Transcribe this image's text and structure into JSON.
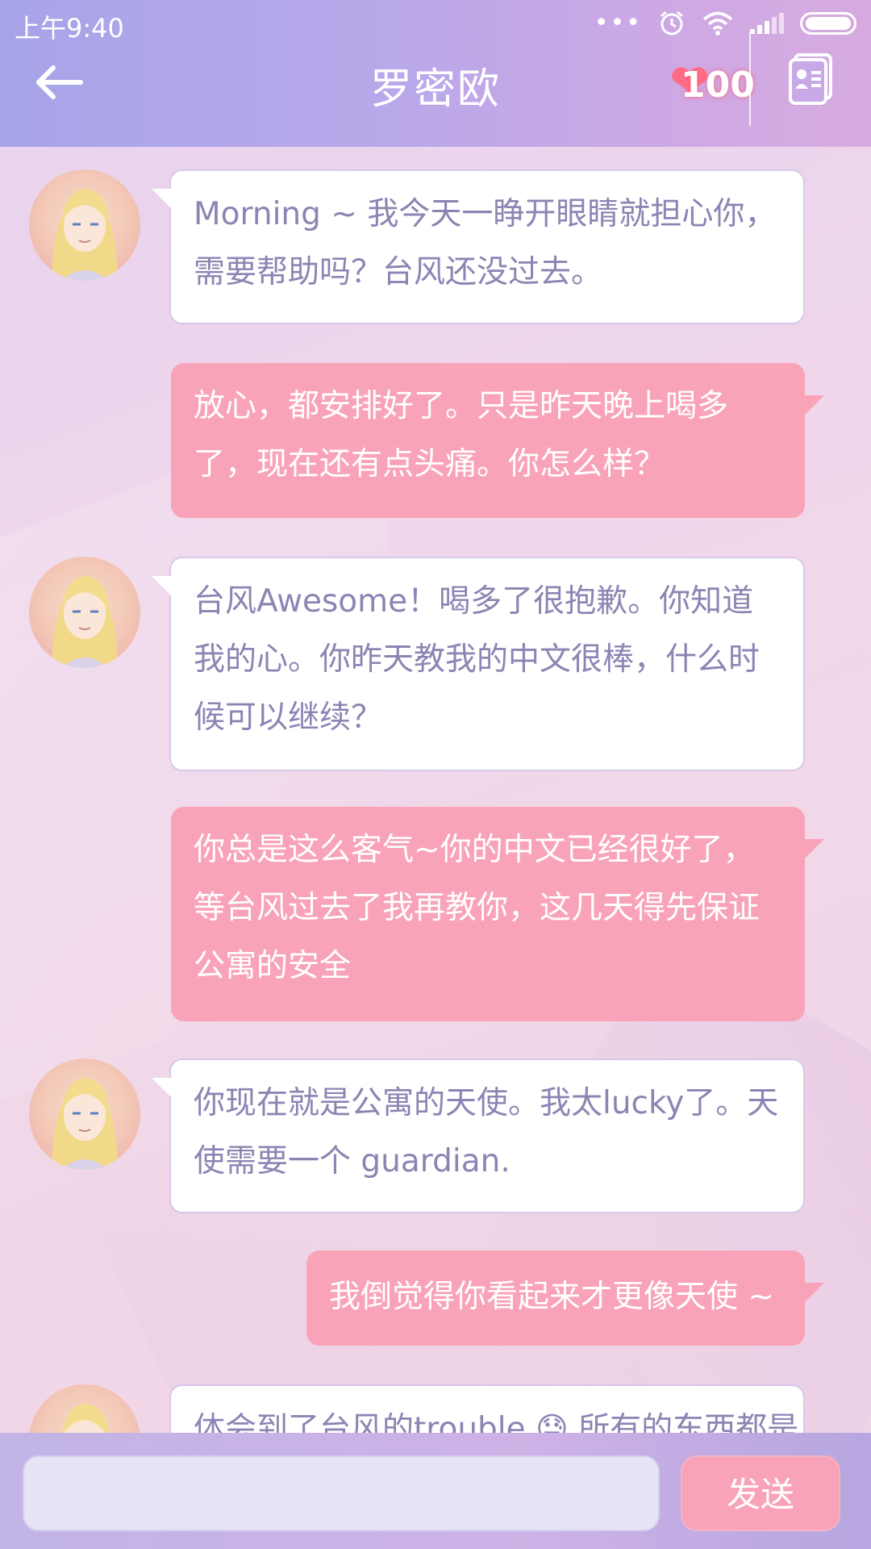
{
  "status_bar": {
    "time": "上午9:40",
    "icons": [
      "more-dots-icon",
      "alarm-icon",
      "wifi-icon",
      "signal-icon",
      "battery-icon"
    ]
  },
  "header": {
    "title": "罗密欧",
    "affection_value": "100",
    "icons": [
      "back-arrow-icon",
      "heart-icon",
      "contact-card-icon"
    ]
  },
  "messages": [
    {
      "side": "left",
      "text": "Morning ~ 我今天一睁开眼睛就担心你，需要帮助吗？台风还没过去。"
    },
    {
      "side": "right",
      "text": "放心，都安排好了。只是昨天晚上喝多了，现在还有点头痛。你怎么样？"
    },
    {
      "side": "left",
      "text": "台风Awesome！喝多了很抱歉。你知道我的心。你昨天教我的中文很棒，什么时候可以继续？"
    },
    {
      "side": "right",
      "text": "你总是这么客气~你的中文已经很好了，等台风过去了我再教你，这几天得先保证公寓的安全"
    },
    {
      "side": "left",
      "text": "你现在就是公寓的天使。我太lucky了。天使需要一个 guardian."
    },
    {
      "side": "right",
      "text": "我倒觉得你看起来才更像天使 ~"
    },
    {
      "side": "left",
      "text": "体会到了台风的trouble 😓 所有的东西都是"
    }
  ],
  "input_bar": {
    "placeholder": "",
    "send_label": "发送"
  },
  "colors": {
    "header_gradient_start": "#a7a4e8",
    "header_gradient_end": "#d6aae0",
    "outgoing_bubble": "#f9a3b8",
    "incoming_text": "#8d84b3",
    "heart": "#ff6c86"
  }
}
